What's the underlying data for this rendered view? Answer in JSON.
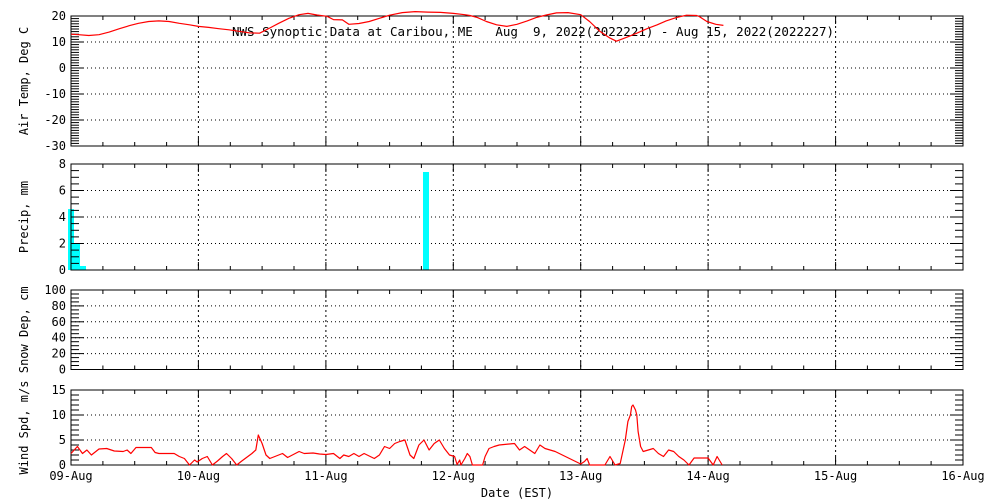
{
  "window": {
    "background": "#ffffff"
  },
  "chart_data": {
    "type": "line",
    "title": "NWS Synoptic Data at Caribou, ME   Aug  9, 2022(2022221) - Aug 15, 2022(2022227)",
    "xlabel": "Date (EST)",
    "x_tick_labels": [
      "09-Aug",
      "10-Aug",
      "11-Aug",
      "12-Aug",
      "13-Aug",
      "14-Aug",
      "15-Aug",
      "16-Aug"
    ],
    "x_range_days": [
      0,
      7
    ],
    "x_minor_ticks_per_day": 4,
    "grid": "dotted horizontal at major y ticks, dotted vertical at interior day ticks",
    "legend_position": "none",
    "colors": {
      "line": "#ff0000",
      "bar": "#00ffff",
      "axis": "#000000",
      "background": "#ffffff"
    },
    "panels": [
      {
        "id": "air-temp",
        "ylabel": "Air Temp, Deg C",
        "ylim": [
          -30,
          20
        ],
        "yticks": [
          -30,
          -20,
          -10,
          0,
          10,
          20
        ],
        "y_minor_step": 1,
        "series_type": "line",
        "series_color": "#ff0000",
        "points": [
          [
            0.0,
            13.0
          ],
          [
            0.06,
            12.8
          ],
          [
            0.14,
            12.5
          ],
          [
            0.22,
            12.8
          ],
          [
            0.3,
            13.8
          ],
          [
            0.38,
            15.1
          ],
          [
            0.46,
            16.3
          ],
          [
            0.53,
            17.2
          ],
          [
            0.61,
            17.9
          ],
          [
            0.69,
            18.1
          ],
          [
            0.77,
            17.9
          ],
          [
            0.85,
            17.2
          ],
          [
            0.93,
            16.6
          ],
          [
            1.0,
            16.0
          ],
          [
            1.08,
            15.6
          ],
          [
            1.16,
            15.1
          ],
          [
            1.24,
            14.7
          ],
          [
            1.32,
            14.1
          ],
          [
            1.4,
            13.5
          ],
          [
            1.48,
            13.4
          ],
          [
            1.56,
            15.4
          ],
          [
            1.63,
            17.2
          ],
          [
            1.71,
            19.1
          ],
          [
            1.79,
            20.5
          ],
          [
            1.86,
            21.0
          ],
          [
            1.93,
            20.4
          ],
          [
            2.01,
            19.9
          ],
          [
            2.06,
            18.6
          ],
          [
            2.13,
            18.5
          ],
          [
            2.18,
            16.8
          ],
          [
            2.26,
            17.1
          ],
          [
            2.34,
            17.9
          ],
          [
            2.42,
            19.1
          ],
          [
            2.5,
            20.3
          ],
          [
            2.6,
            21.3
          ],
          [
            2.7,
            21.7
          ],
          [
            2.8,
            21.5
          ],
          [
            2.9,
            21.4
          ],
          [
            3.0,
            21.0
          ],
          [
            3.09,
            20.5
          ],
          [
            3.13,
            20.2
          ],
          [
            3.19,
            19.4
          ],
          [
            3.26,
            17.9
          ],
          [
            3.34,
            16.6
          ],
          [
            3.42,
            16.0
          ],
          [
            3.5,
            16.8
          ],
          [
            3.58,
            18.1
          ],
          [
            3.65,
            19.4
          ],
          [
            3.73,
            20.4
          ],
          [
            3.81,
            21.2
          ],
          [
            3.9,
            21.3
          ],
          [
            4.0,
            20.5
          ],
          [
            4.07,
            17.9
          ],
          [
            4.15,
            14.1
          ],
          [
            4.23,
            11.5
          ],
          [
            4.28,
            10.3
          ],
          [
            4.36,
            11.8
          ],
          [
            4.44,
            13.4
          ],
          [
            4.52,
            15.1
          ],
          [
            4.6,
            16.6
          ],
          [
            4.67,
            18.1
          ],
          [
            4.75,
            19.4
          ],
          [
            4.83,
            20.3
          ],
          [
            4.91,
            20.2
          ],
          [
            4.93,
            19.8
          ],
          [
            4.99,
            17.9
          ],
          [
            5.06,
            16.8
          ],
          [
            5.12,
            16.4
          ]
        ]
      },
      {
        "id": "precip",
        "ylabel": "Precip, mm",
        "ylim": [
          0,
          8
        ],
        "yticks": [
          0,
          2,
          4,
          6,
          8
        ],
        "y_minor_step": 0.5,
        "series_type": "bar",
        "series_color": "#00ffff",
        "bar_width_days": 0.047,
        "bars": [
          {
            "x_days": 0.0,
            "mm": 4.6
          },
          {
            "x_days": 0.047,
            "mm": 2.0
          },
          {
            "x_days": 0.094,
            "mm": 0.3
          },
          {
            "x_days": 2.786,
            "mm": 7.4
          }
        ]
      },
      {
        "id": "snow-depth",
        "ylabel": "Snow Dep, cm",
        "ylim": [
          0,
          100
        ],
        "yticks": [
          0,
          20,
          40,
          60,
          80,
          100
        ],
        "y_minor_step": 5,
        "series_type": "line",
        "series_color": "#ff0000",
        "points": []
      },
      {
        "id": "wind-speed",
        "ylabel": "Wind Spd, m/s",
        "ylim": [
          0,
          15
        ],
        "yticks": [
          0,
          5,
          10,
          15
        ],
        "y_minor_step": 1,
        "series_type": "line",
        "series_color": "#ff0000",
        "points": [
          [
            0.0,
            2.3
          ],
          [
            0.05,
            3.7
          ],
          [
            0.09,
            2.3
          ],
          [
            0.125,
            3.0
          ],
          [
            0.16,
            2.0
          ],
          [
            0.22,
            3.2
          ],
          [
            0.28,
            3.3
          ],
          [
            0.34,
            2.8
          ],
          [
            0.41,
            2.7
          ],
          [
            0.44,
            3.0
          ],
          [
            0.47,
            2.3
          ],
          [
            0.51,
            3.5
          ],
          [
            0.63,
            3.5
          ],
          [
            0.66,
            2.5
          ],
          [
            0.69,
            2.3
          ],
          [
            0.81,
            2.3
          ],
          [
            0.85,
            1.7
          ],
          [
            0.89,
            1.3
          ],
          [
            0.93,
            0.0
          ],
          [
            0.97,
            1.0
          ],
          [
            0.99,
            0.6
          ],
          [
            1.03,
            1.3
          ],
          [
            1.07,
            1.7
          ],
          [
            1.11,
            0.0
          ],
          [
            1.15,
            0.8
          ],
          [
            1.19,
            1.7
          ],
          [
            1.22,
            2.3
          ],
          [
            1.26,
            1.3
          ],
          [
            1.3,
            0.0
          ],
          [
            1.34,
            0.8
          ],
          [
            1.42,
            2.3
          ],
          [
            1.45,
            3.0
          ],
          [
            1.47,
            6.0
          ],
          [
            1.5,
            4.3
          ],
          [
            1.53,
            2.0
          ],
          [
            1.56,
            1.3
          ],
          [
            1.6,
            1.7
          ],
          [
            1.66,
            2.3
          ],
          [
            1.7,
            1.5
          ],
          [
            1.79,
            2.7
          ],
          [
            1.83,
            2.3
          ],
          [
            1.9,
            2.4
          ],
          [
            1.95,
            2.2
          ],
          [
            2.0,
            2.1
          ],
          [
            2.06,
            2.3
          ],
          [
            2.11,
            1.3
          ],
          [
            2.14,
            2.0
          ],
          [
            2.18,
            1.7
          ],
          [
            2.22,
            2.3
          ],
          [
            2.26,
            1.7
          ],
          [
            2.3,
            2.3
          ],
          [
            2.38,
            1.3
          ],
          [
            2.42,
            2.0
          ],
          [
            2.46,
            3.7
          ],
          [
            2.5,
            3.3
          ],
          [
            2.54,
            4.3
          ],
          [
            2.58,
            4.7
          ],
          [
            2.62,
            5.0
          ],
          [
            2.66,
            2.0
          ],
          [
            2.69,
            1.3
          ],
          [
            2.73,
            4.0
          ],
          [
            2.77,
            5.0
          ],
          [
            2.81,
            3.0
          ],
          [
            2.85,
            4.3
          ],
          [
            2.89,
            5.0
          ],
          [
            2.93,
            3.3
          ],
          [
            2.97,
            2.0
          ],
          [
            3.01,
            1.7
          ],
          [
            3.03,
            0.1
          ],
          [
            3.05,
            1.0
          ],
          [
            3.06,
            0.0
          ],
          [
            3.09,
            1.3
          ],
          [
            3.11,
            2.3
          ],
          [
            3.13,
            1.7
          ],
          [
            3.15,
            0.0
          ],
          [
            3.23,
            0.0
          ],
          [
            3.25,
            1.7
          ],
          [
            3.28,
            3.3
          ],
          [
            3.32,
            3.7
          ],
          [
            3.36,
            4.0
          ],
          [
            3.48,
            4.3
          ],
          [
            3.52,
            3.0
          ],
          [
            3.56,
            3.7
          ],
          [
            3.64,
            2.3
          ],
          [
            3.68,
            4.0
          ],
          [
            3.72,
            3.3
          ],
          [
            3.8,
            2.7
          ],
          [
            3.88,
            1.7
          ],
          [
            3.96,
            0.7
          ],
          [
            4.0,
            0.2
          ],
          [
            4.03,
            0.7
          ],
          [
            4.05,
            1.3
          ],
          [
            4.07,
            0.0
          ],
          [
            4.19,
            0.0
          ],
          [
            4.23,
            1.7
          ],
          [
            4.27,
            0.0
          ],
          [
            4.31,
            0.3
          ],
          [
            4.35,
            5.0
          ],
          [
            4.37,
            8.7
          ],
          [
            4.39,
            10.0
          ],
          [
            4.4,
            11.7
          ],
          [
            4.41,
            12.0
          ],
          [
            4.43,
            11.0
          ],
          [
            4.44,
            10.0
          ],
          [
            4.45,
            6.7
          ],
          [
            4.47,
            3.7
          ],
          [
            4.49,
            2.7
          ],
          [
            4.53,
            3.0
          ],
          [
            4.57,
            3.3
          ],
          [
            4.61,
            2.3
          ],
          [
            4.65,
            1.7
          ],
          [
            4.69,
            3.0
          ],
          [
            4.73,
            2.7
          ],
          [
            4.77,
            1.7
          ],
          [
            4.81,
            1.0
          ],
          [
            4.85,
            0.0
          ],
          [
            4.89,
            1.4
          ],
          [
            5.0,
            1.4
          ],
          [
            5.04,
            0.0
          ],
          [
            5.07,
            1.7
          ],
          [
            5.11,
            0.0
          ]
        ]
      }
    ]
  }
}
